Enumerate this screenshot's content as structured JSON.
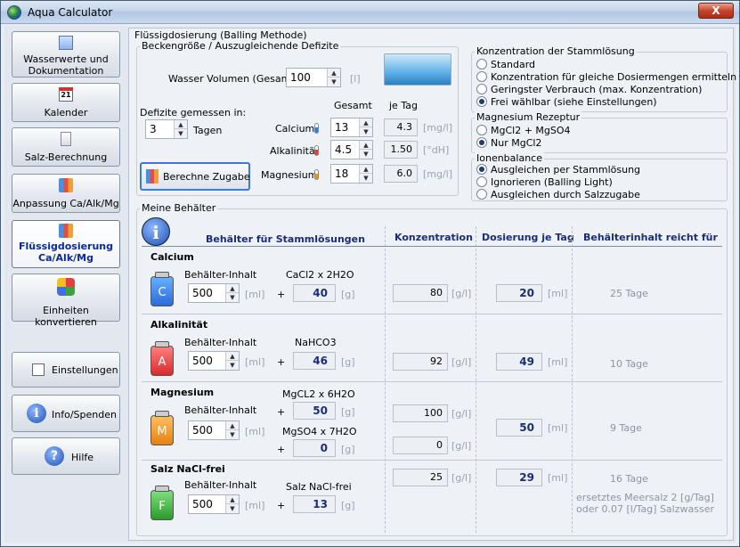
{
  "window": {
    "title": "Aqua Calculator",
    "close": "X"
  },
  "sidebar": {
    "items": [
      {
        "label": "Wasserwerte und Dokumentation",
        "icon": "chart-icon"
      },
      {
        "label": "Kalender",
        "icon": "calendar-icon"
      },
      {
        "label": "Salz-Berechnung",
        "icon": "salt-icon"
      },
      {
        "label": "Anpassung Ca/Alk/Mg",
        "icon": "bottles-icon"
      },
      {
        "label": "Flüssigdosierung Ca/Alk/Mg",
        "icon": "dosing-icon"
      },
      {
        "label": "Einheiten konvertieren",
        "icon": "convert-icon"
      }
    ],
    "settings": "Einstellungen",
    "info": "Info/Spenden",
    "help": "Hilfe"
  },
  "main": {
    "title": "Flüssigdosierung (Balling Methode)",
    "tank": {
      "group_title": "Beckengröße / Auszugleichende Defizite",
      "volume_label": "Wasser Volumen (Gesamt)",
      "volume_value": "100",
      "volume_unit": "[l]",
      "deficit_label": "Defizite gemessen in:",
      "days_value": "3",
      "days_label": "Tagen",
      "col_total": "Gesamt",
      "col_perday": "je Tag",
      "rows": [
        {
          "label": "Calcium",
          "total": "13",
          "perday": "4.3",
          "unit": "[mg/l]"
        },
        {
          "label": "Alkalinität",
          "total": "4.5",
          "perday": "1.50",
          "unit": "[°dH]"
        },
        {
          "label": "Magnesium",
          "total": "18",
          "perday": "6.0",
          "unit": "[mg/l]"
        }
      ],
      "calc_button": "Berechne Zugabe"
    },
    "concentration": {
      "title": "Konzentration der Stammlösung",
      "options": [
        "Standard",
        "Konzentration für gleiche Dosiermengen ermitteln",
        "Geringster Verbrauch (max. Konzentration)",
        "Frei wählbar (siehe Einstellungen)"
      ],
      "selected": 3
    },
    "magnesium": {
      "title": "Magnesium Rezeptur",
      "options": [
        "MgCl2 + MgSO4",
        "Nur MgCl2"
      ],
      "selected": 1
    },
    "ion": {
      "title": "Ionenbalance",
      "options": [
        "Ausgleichen per Stammlösung",
        "Ignorieren (Balling Light)",
        "Ausgleichen durch Salzzugabe"
      ],
      "selected": 0
    },
    "containers": {
      "group_title": "Meine Behälter",
      "headers": {
        "stock": "Behälter für Stammlösungen",
        "conc": "Konzentration",
        "dose": "Dosierung je Tag",
        "reach": "Behälterinhalt reicht für"
      },
      "content_label": "Behälter-Inhalt",
      "unit_ml": "[ml]",
      "unit_g": "[g]",
      "unit_gl": "[g/l]",
      "calcium": {
        "title": "Calcium",
        "volume": "500",
        "chem": "CaCl2 x 2H2O",
        "grams": "40",
        "conc": "80",
        "dose": "20",
        "reach": "25 Tage",
        "letter": "C"
      },
      "alk": {
        "title": "Alkalinität",
        "volume": "500",
        "chem": "NaHCO3",
        "grams": "46",
        "conc": "92",
        "dose": "49",
        "reach": "10 Tage",
        "letter": "A"
      },
      "mg": {
        "title": "Magnesium",
        "volume": "500",
        "chem1": "MgCL2 x 6H2O",
        "grams1": "50",
        "conc1": "100",
        "chem2": "MgSO4 x 7H2O",
        "grams2": "0",
        "conc2": "0",
        "dose": "50",
        "reach": "9 Tage",
        "letter": "M"
      },
      "salt": {
        "title": "Salz NaCl-frei",
        "volume": "500",
        "chem": "Salz NaCl-frei",
        "grams": "13",
        "conc": "25",
        "dose": "29",
        "reach": "16 Tage",
        "note1": "ersetztes Meersalz 2 [g/Tag]",
        "note2": "oder 0.07 [l/Tag] Salzwasser",
        "letter": "F"
      }
    }
  }
}
